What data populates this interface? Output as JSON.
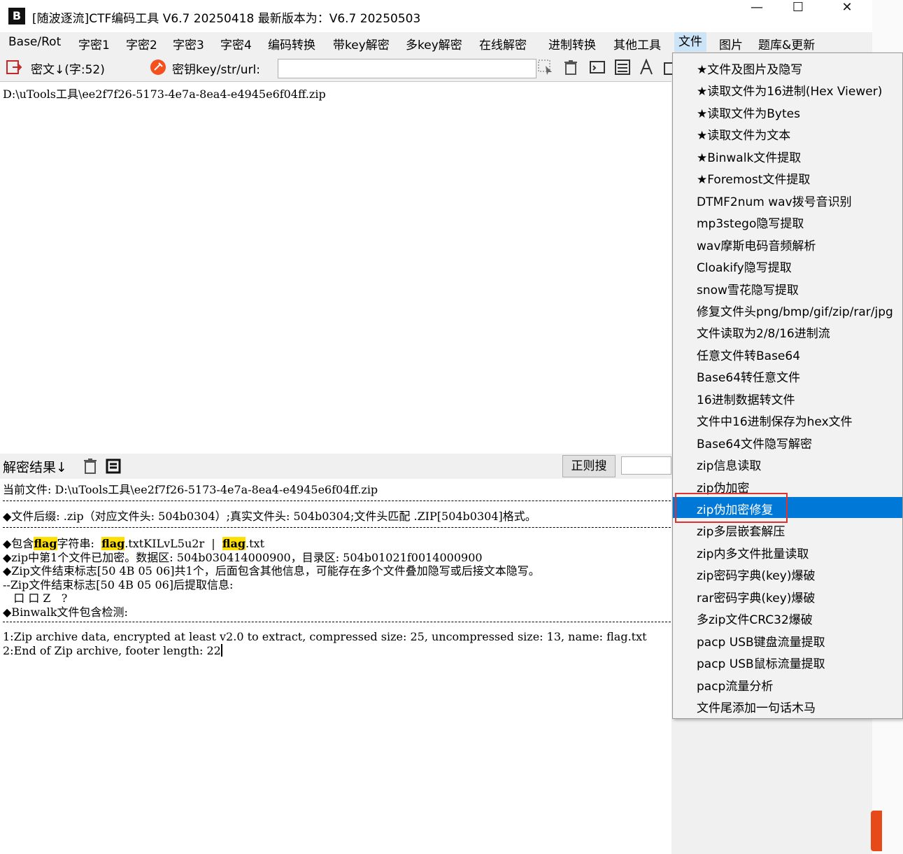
{
  "window": {
    "title": "[随波逐流]CTF编码工具 V6.7 20250418     最新版本为：V6.7  20250503",
    "logo": "B",
    "buttons": {
      "minimize": "—",
      "maximize": "☐",
      "close": "✕"
    }
  },
  "menubar": [
    "Base/Rot",
    "字密1",
    "字密2",
    "字密3",
    "字密4",
    "编码转换",
    "带key解密",
    "多key解密",
    "在线解密",
    "进制转换",
    "其他工具",
    "文件",
    "图片",
    "题库&更新"
  ],
  "toolbar": {
    "cipher_label": "密文↓(字:52)",
    "key_label": "密钥key/str/url:",
    "key_value": ""
  },
  "editor": {
    "content": "D:\\uTools工具\\ee2f7f26-5173-4e7a-8ea4-e4945e6f04ff.zip"
  },
  "result": {
    "label": "解密结果↓",
    "regex_button": "正则搜",
    "regex_value": "",
    "lines": {
      "current_file": "当前文件: D:\\uTools工具\\ee2f7f26-5173-4e7a-8ea4-e4945e6f04ff.zip",
      "suffix": "◆文件后缀: .zip（对应文件头: 504b0304）;真实文件头: 504b0304;文件头匹配 .ZIP[504b0304]格式。",
      "flag_prefix": "◆包含",
      "flag_word": "flag",
      "flag_mid": "字符串:  ",
      "flag_item1_rest": ".txtKILvL5u2r  |  ",
      "flag_item2_rest": ".txt",
      "encrypted": "◆zip中第1个文件已加密。数据区: 504b030414000900，目录区: 504b01021f0014000900",
      "end_marker": "◆Zip文件结束标志[50 4B 05 06]共1个，后面包含其他信息，可能存在多个文件叠加隐写或后接文本隐写。",
      "after_marker": "--Zip文件结束标志[50 4B 05 06]后提取信息:",
      "extracted": "   口 口 Z   ?",
      "binwalk": "◆Binwalk文件包含检测:",
      "bw1": "1:Zip archive data, encrypted at least v2.0 to extract, compressed size: 25, uncompressed size: 13, name: flag.txt",
      "bw2": "2:End of Zip archive, footer length: 22"
    }
  },
  "file_menu": {
    "items": [
      "★文件及图片及隐写",
      "★读取文件为16进制(Hex Viewer)",
      "★读取文件为Bytes",
      "★读取文件为文本",
      "★Binwalk文件提取",
      "★Foremost文件提取",
      "DTMF2num  wav拨号音识别",
      "mp3stego隐写提取",
      "wav摩斯电码音频解析",
      "Cloakify隐写提取",
      "snow雪花隐写提取",
      "修复文件头png/bmp/gif/zip/rar/jpg",
      "文件读取为2/8/16进制流",
      "任意文件转Base64",
      "Base64转任意文件",
      "16进制数据转文件",
      "文件中16进制保存为hex文件",
      "Base64文件隐写解密",
      "zip信息读取",
      "zip伪加密",
      "zip伪加密修复",
      "zip多层嵌套解压",
      "zip内多文件批量读取",
      "zip密码字典(key)爆破",
      "rar密码字典(key)爆破",
      "多zip文件CRC32爆破",
      "pacp USB键盘流量提取",
      "pacp USB鼠标流量提取",
      "pacp流量分析",
      "文件尾添加一句话木马"
    ],
    "selected": "zip伪加密修复"
  },
  "colors": {
    "menu_selected": "#0078d7",
    "highlight": "#ffe000",
    "annotation_box": "#e03030"
  }
}
